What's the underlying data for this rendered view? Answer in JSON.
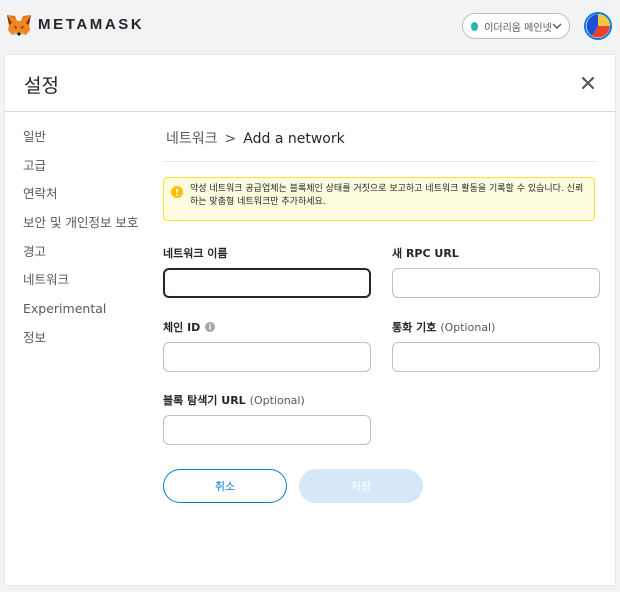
{
  "header": {
    "brand": "METAMASK",
    "network": {
      "label": "이더리움 메인넷",
      "dot_color": "#29b6af"
    }
  },
  "settings": {
    "title": "설정",
    "sidebar": {
      "items": [
        {
          "label": "일반"
        },
        {
          "label": "고급"
        },
        {
          "label": "연락처"
        },
        {
          "label": "보안 및 개인정보 보호"
        },
        {
          "label": "경고"
        },
        {
          "label": "네트워크"
        },
        {
          "label": "Experimental"
        },
        {
          "label": "정보"
        }
      ]
    }
  },
  "breadcrumb": {
    "parent": "네트워크",
    "separator": ">",
    "current": "Add a network"
  },
  "warning": {
    "text": "악성 네트워크 공급업체는 블록체인 상태를 거짓으로 보고하고 네트워크 활동을 기록할 수 있습니다. 신뢰하는 맞춤형 네트워크만 추가하세요."
  },
  "form": {
    "network_name": {
      "label": "네트워크 이름",
      "value": ""
    },
    "rpc_url": {
      "label": "새 RPC URL",
      "value": ""
    },
    "chain_id": {
      "label": "체인 ID",
      "value": ""
    },
    "currency_symbol": {
      "label": "통화 기호",
      "optional": "(Optional)",
      "value": ""
    },
    "explorer_url": {
      "label": "블록 탐색기 URL",
      "optional": "(Optional)",
      "value": ""
    }
  },
  "buttons": {
    "cancel": "취소",
    "save": "저장"
  },
  "colors": {
    "accent": "#037dd6",
    "warning_bg": "#fefcde",
    "warning_border": "#f8e33b",
    "save_disabled": "#d6e8f7"
  }
}
